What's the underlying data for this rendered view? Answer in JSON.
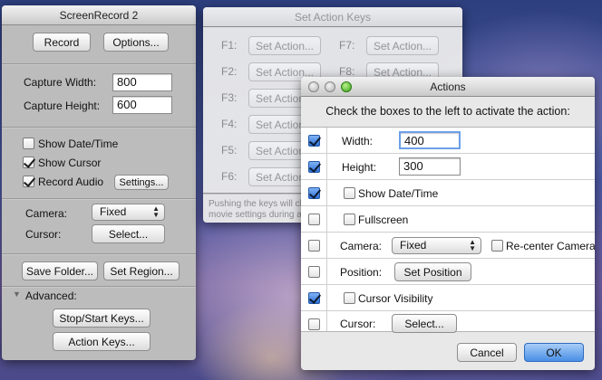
{
  "screenrecord": {
    "title": "ScreenRecord 2",
    "record_label": "Record",
    "options_label": "Options...",
    "capture_width_label": "Capture Width:",
    "capture_width_value": "800",
    "capture_height_label": "Capture Height:",
    "capture_height_value": "600",
    "show_date_time_label": "Show Date/Time",
    "show_cursor_label": "Show Cursor",
    "record_audio_label": "Record Audio",
    "settings_label": "Settings...",
    "camera_label": "Camera:",
    "camera_value": "Fixed",
    "cursor_label": "Cursor:",
    "cursor_select_label": "Select...",
    "save_folder_label": "Save Folder...",
    "set_region_label": "Set Region...",
    "advanced_label": "Advanced:",
    "stop_start_keys_label": "Stop/Start Keys...",
    "action_keys_label": "Action Keys..."
  },
  "set_action_keys": {
    "title": "Set Action Keys",
    "button_label": "Set Action...",
    "keys": [
      "F1:",
      "F2:",
      "F3:",
      "F4:",
      "F5:",
      "F6:",
      "F7:",
      "F8:"
    ],
    "footer_line1": "Pushing the keys will cha",
    "footer_line2": "movie settings during a c"
  },
  "actions": {
    "title": "Actions",
    "instruction": "Check the boxes to the left to activate the action:",
    "width_label": "Width:",
    "width_value": "400",
    "height_label": "Height:",
    "height_value": "300",
    "show_date_time_label": "Show Date/Time",
    "fullscreen_label": "Fullscreen",
    "camera_label": "Camera:",
    "camera_value": "Fixed",
    "recenter_label": "Re-center Camera",
    "position_label": "Position:",
    "set_position_label": "Set Position",
    "cursor_visibility_label": "Cursor Visibility",
    "cursor_label": "Cursor:",
    "cursor_select_label": "Select...",
    "cancel_label": "Cancel",
    "ok_label": "OK"
  },
  "colors": {
    "accent": "#2f71d6",
    "desktop": "#3c4c94"
  }
}
